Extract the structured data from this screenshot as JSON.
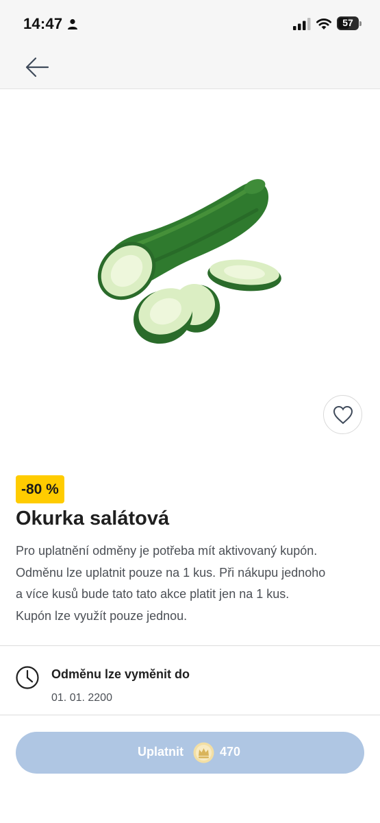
{
  "status_bar": {
    "time": "14:47",
    "battery": "57",
    "icons": [
      "person-icon",
      "signal-icon",
      "wifi-icon",
      "battery-icon"
    ]
  },
  "nav": {
    "back_icon": "arrow-left-icon"
  },
  "product": {
    "image": "cucumber-image",
    "discount": "-80 %",
    "title": "Okurka salátová",
    "description_lines": [
      "Pro uplatnění odměny je potřeba mít aktivovaný kupón.",
      "Odměnu lze uplatnit pouze na 1 kus. Při nákupu jednoho",
      "a více kusů bude tato tato akce platit jen na 1 kus.",
      "Kupón lze využít pouze jednou."
    ],
    "favorite_icon": "heart-outline-icon"
  },
  "expiry": {
    "label": "Odměnu lze vyměnit do",
    "date": "01. 01. 2200",
    "icon": "clock-icon"
  },
  "redeem": {
    "label": "Uplatnit",
    "points": "470",
    "coin_icon": "crown-coin-icon"
  },
  "colors": {
    "badge_yellow": "#ffcc00",
    "button_disabled_blue": "#afc6e3",
    "cucumber_green": "#2f7a2e"
  }
}
